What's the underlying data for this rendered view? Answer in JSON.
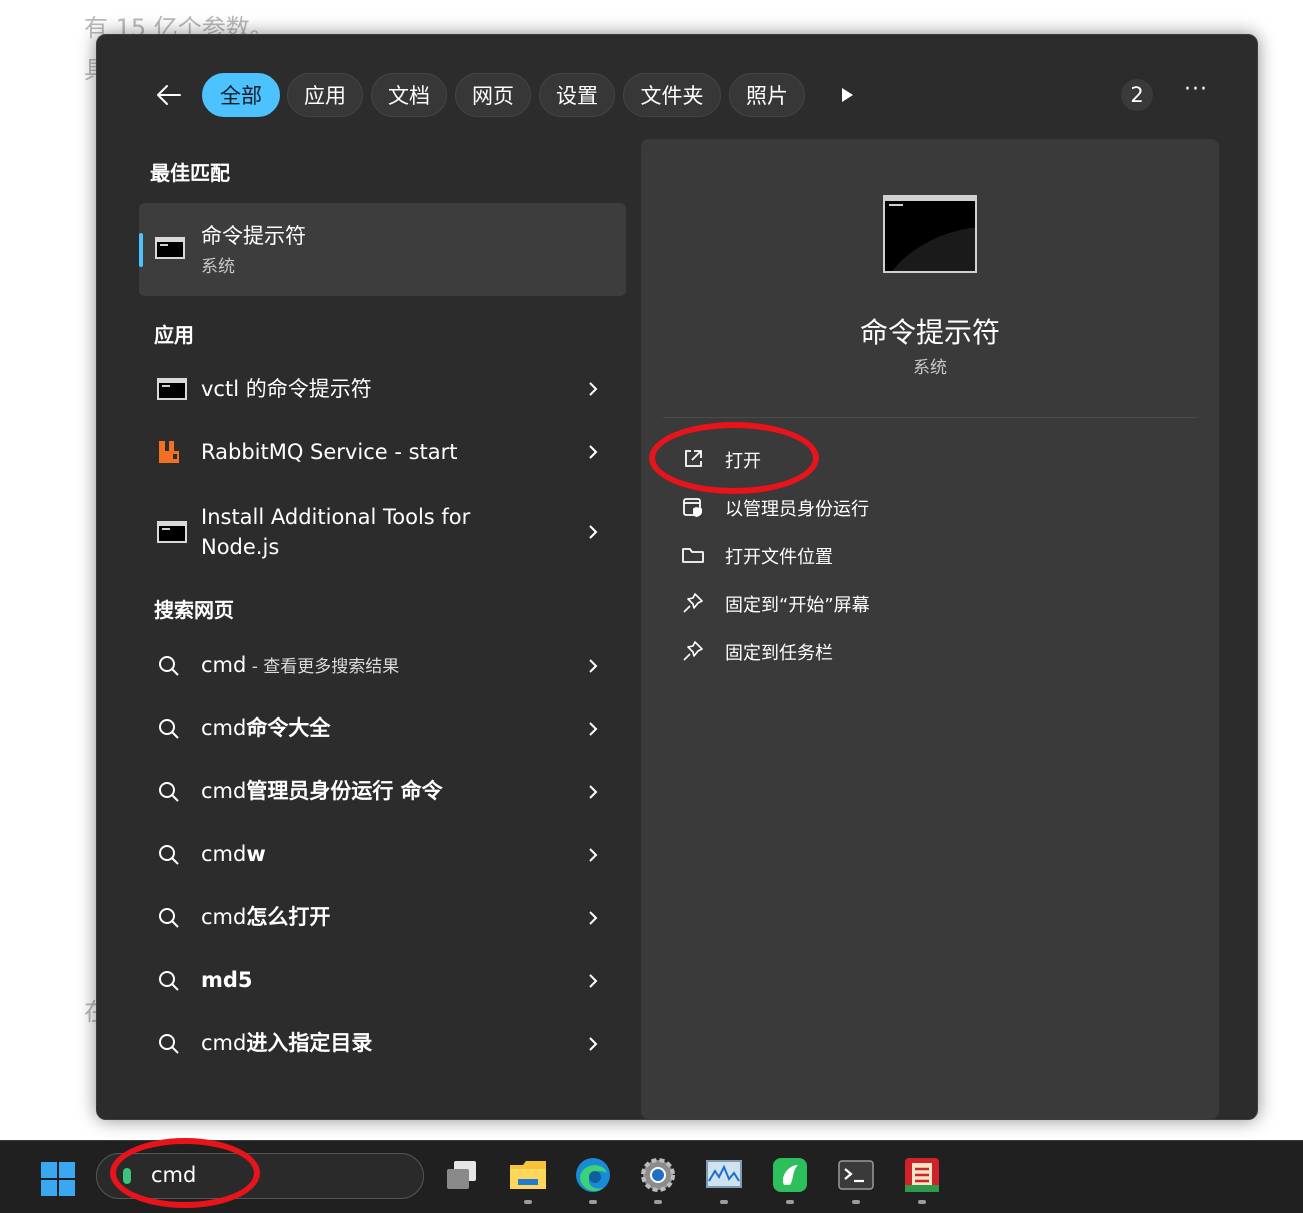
{
  "background_doc": {
    "line1": "有 15 亿个参数。",
    "line2": "具",
    "line3": "在"
  },
  "tabs": [
    {
      "label": "全部",
      "active": true
    },
    {
      "label": "应用"
    },
    {
      "label": "文档"
    },
    {
      "label": "网页"
    },
    {
      "label": "设置"
    },
    {
      "label": "文件夹"
    },
    {
      "label": "照片"
    }
  ],
  "badge_count": "2",
  "more_label": "···",
  "sections": {
    "best_match": "最佳匹配",
    "apps": "应用",
    "web": "搜索网页"
  },
  "best_match": {
    "title": "命令提示符",
    "subtitle": "系统"
  },
  "apps": [
    {
      "label": "vctl 的命令提示符",
      "icon": "cmd-icon"
    },
    {
      "label": "RabbitMQ Service - start",
      "icon": "rabbitmq-icon"
    },
    {
      "label": "Install Additional Tools for Node.js",
      "icon": "cmd-icon"
    }
  ],
  "web_results": [
    {
      "prefix": "cmd",
      "bold": "",
      "suffix": " - 查看更多搜索结果"
    },
    {
      "prefix": "cmd",
      "bold": "命令大全",
      "suffix": ""
    },
    {
      "prefix": "cmd",
      "bold": "管理员身份运行 命令",
      "suffix": ""
    },
    {
      "prefix": "cmd",
      "bold": "w",
      "suffix": ""
    },
    {
      "prefix": "cmd",
      "bold": "怎么打开",
      "suffix": ""
    },
    {
      "prefix": "",
      "bold": "md5",
      "suffix": ""
    },
    {
      "prefix": "cmd",
      "bold": "进入指定目录",
      "suffix": ""
    }
  ],
  "detail": {
    "title": "命令提示符",
    "subtitle": "系统",
    "actions": [
      {
        "label": "打开",
        "icon": "open-external-icon"
      },
      {
        "label": "以管理员身份运行",
        "icon": "run-as-admin-icon"
      },
      {
        "label": "打开文件位置",
        "icon": "folder-icon"
      },
      {
        "label": "固定到“开始”屏幕",
        "icon": "pin-icon"
      },
      {
        "label": "固定到任务栏",
        "icon": "pin-icon"
      }
    ]
  },
  "taskbar": {
    "search_value": "cmd",
    "apps": [
      "task-view-icon",
      "file-explorer-icon",
      "edge-icon",
      "settings-icon",
      "resource-monitor-icon",
      "app-green-icon",
      "terminal-icon",
      "app-red-icon"
    ]
  },
  "colors": {
    "accent": "#4cc2ff",
    "annotation": "#e8131b"
  }
}
